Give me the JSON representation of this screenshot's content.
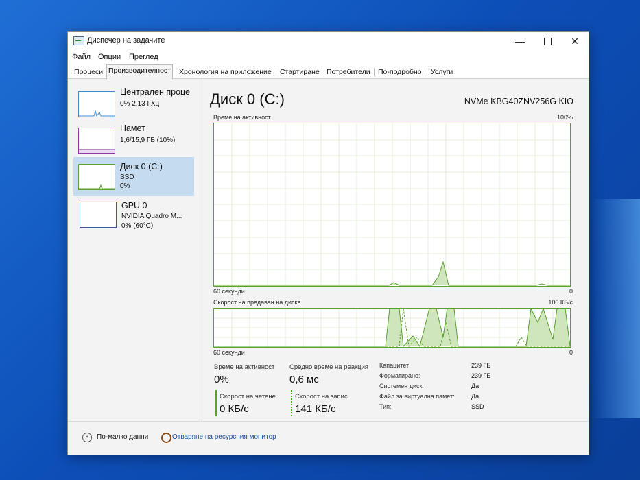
{
  "window": {
    "title": "Диспечер на задачите",
    "controls": {
      "minimize": "—",
      "maximize": "",
      "close": "✕"
    }
  },
  "menu": [
    "Файл",
    "Опции",
    "Преглед"
  ],
  "tabs": [
    "Процеси",
    "Производителност",
    "Хронология на приложение",
    "Стартиране",
    "Потребители",
    "По-подробно",
    "Услуги"
  ],
  "active_tab": "Производителност",
  "sidebar": [
    {
      "name": "Централен проце",
      "sub1": "0%  2,13 ГХц",
      "sub2": ""
    },
    {
      "name": "Памет",
      "sub1": "1,6/15,9 ГБ (10%)",
      "sub2": ""
    },
    {
      "name": "Диск 0 (C:)",
      "sub1": "SSD",
      "sub2": "0%"
    },
    {
      "name": "GPU 0",
      "sub1": "NVIDIA Quadro M...",
      "sub2": "0%  (60°C)"
    }
  ],
  "disk": {
    "title": "Диск 0 (C:)",
    "model": "NVMe KBG40ZNV256G KIO",
    "graph1": {
      "label": "Време на активност",
      "max": "100%",
      "time": "60 секунди",
      "min": "0"
    },
    "graph2": {
      "label": "Скорост на предаван на диска",
      "max": "100 КБ/с",
      "time": "60 секунди",
      "min": "0"
    },
    "stats": {
      "active_time_label": "Време на активност",
      "active_time": "0%",
      "response_label": "Средно време на реакция",
      "response": "0,6 мс",
      "read_label": "Скорост на четене",
      "read": "0 КБ/с",
      "write_label": "Скорост на запис",
      "write": "141 КБ/с"
    },
    "props": [
      {
        "k": "Капацитет:",
        "v": "239 ГБ"
      },
      {
        "k": "Форматирано:",
        "v": "239 ГБ"
      },
      {
        "k": "Системен диск:",
        "v": "Да"
      },
      {
        "k": "Файл за виртуална памет:",
        "v": "Да"
      },
      {
        "k": "Тип:",
        "v": "SSD"
      }
    ]
  },
  "footer": {
    "less": "По-малко данни",
    "monitor": "Отваряне на ресурсния монитор"
  },
  "colors": {
    "accent_green": "#5aa12e",
    "selected": "#c5dcf0",
    "link": "#1a4fa0"
  }
}
